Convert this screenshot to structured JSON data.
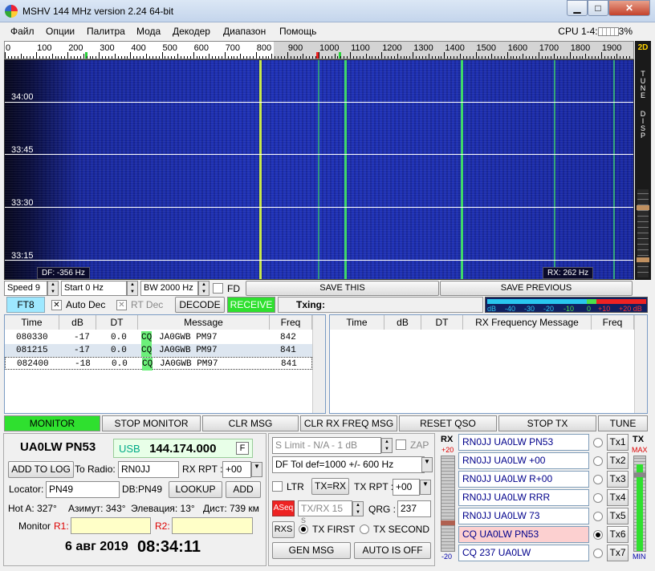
{
  "window": {
    "title": "MSHV 144 MHz version 2.24 64-bit",
    "min": "▁",
    "max": "□",
    "close": "✕"
  },
  "menu": [
    "Файл",
    "Опции",
    "Палитра",
    "Мода",
    "Декодер",
    "Диапазон",
    "Помощь"
  ],
  "cpu": {
    "label": "CPU 1-4:",
    "value": "3%"
  },
  "scale": {
    "labels": [
      "0",
      "100",
      "200",
      "300",
      "400",
      "500",
      "600",
      "700",
      "800",
      "900",
      "1000",
      "1100",
      "1200",
      "1300",
      "1400",
      "1500",
      "1600",
      "1700",
      "1800",
      "1900"
    ],
    "mode": "2D"
  },
  "waterfall": {
    "times": [
      "34:00",
      "33:45",
      "33:30",
      "33:15"
    ],
    "df": "DF: -356 Hz",
    "rx": "RX: 262 Hz",
    "side": [
      "TUNE",
      "DISP"
    ]
  },
  "controls": {
    "speed": "Speed 9",
    "start": "Start 0 Hz",
    "bw": "BW 2000 Hz",
    "fd": "FD",
    "save_this": "SAVE THIS",
    "save_prev": "SAVE PREVIOUS"
  },
  "decode": {
    "mode": "FT8",
    "auto_dec": "Auto Dec",
    "rt_dec": "RT Dec",
    "decode": "DECODE",
    "receive": "RECEIVE",
    "txing": "Txing:"
  },
  "meter": {
    "labels": [
      "dB",
      "-40",
      "-30",
      "-20",
      "-10",
      "0",
      "+10",
      "+20 dB"
    ]
  },
  "left_table": {
    "headers": [
      "Time",
      "dB",
      "DT",
      "Message",
      "Freq"
    ],
    "rows": [
      {
        "time": "080330",
        "db": "-17",
        "dt": "0.0",
        "cq": "CQ",
        "msg": "JA0GWB PM97",
        "freq": "842"
      },
      {
        "time": "081215",
        "db": "-17",
        "dt": "0.0",
        "cq": "CQ",
        "msg": "JA0GWB PM97",
        "freq": "841"
      },
      {
        "time": "082400",
        "db": "-18",
        "dt": "0.0",
        "cq": "CQ",
        "msg": "JA0GWB PM97",
        "freq": "841"
      }
    ]
  },
  "right_table": {
    "headers": [
      "Time",
      "dB",
      "DT",
      "RX Frequency Message",
      "Freq"
    ]
  },
  "actions": [
    "MONITOR",
    "STOP MONITOR",
    "CLR MSG",
    "CLR RX FREQ MSG",
    "RESET QSO",
    "STOP TX",
    "TUNE"
  ],
  "station": {
    "call": "UA0LW PN53",
    "mode": "USB",
    "freq": "144.174.000",
    "f": "F",
    "add_log": "ADD TO LOG",
    "to_radio": "To Radio:",
    "to_call": "RN0JJ",
    "rx_rpt": "RX RPT :",
    "rx_rpt_val": "+00",
    "locator_label": "Locator:",
    "locator": "PN49",
    "db_loc": "DB:PN49",
    "lookup": "LOOKUP",
    "add": "ADD",
    "hot": "Hot A: 327°",
    "azimuth": "Азимут: 343°",
    "elev": "Элевация: 13°",
    "dist": "Дист: 739 км",
    "monitor": "Monitor",
    "r1": "R1:",
    "r2": "R2:",
    "date": "6 авг 2019",
    "time": "08:34:11"
  },
  "mid": {
    "slimit": "S Limit - N/A - 1  dB",
    "zap": "ZAP",
    "dftol": "DF Tol def=1000 +/-  600  Hz",
    "ltr": "LTR",
    "txrx": "TX=RX",
    "tx_rpt": "TX RPT :",
    "tx_rpt_val": "+00",
    "aseq": "ASeq",
    "txrx15": "TX/RX 15  s",
    "qrg": "QRG :",
    "qrg_val": "237",
    "rxs": "RXS",
    "txfirst": "TX FIRST",
    "txsecond": "TX SECOND",
    "genmsg": "GEN MSG",
    "auto": "AUTO IS OFF"
  },
  "tx": {
    "rx_label": "RX",
    "plus20": "+20",
    "minus20": "-20",
    "tx_label": "TX",
    "max": "MAX",
    "min": "MIN",
    "msgs": [
      "RN0JJ UA0LW PN53",
      "RN0JJ UA0LW +00",
      "RN0JJ UA0LW R+00",
      "RN0JJ UA0LW RRR",
      "RN0JJ UA0LW 73",
      "CQ UA0LW PN53",
      "CQ 237 UA0LW"
    ],
    "btns": [
      "Tx1",
      "Tx2",
      "Tx3",
      "Tx4",
      "Tx5",
      "Tx6",
      "Tx7"
    ]
  }
}
